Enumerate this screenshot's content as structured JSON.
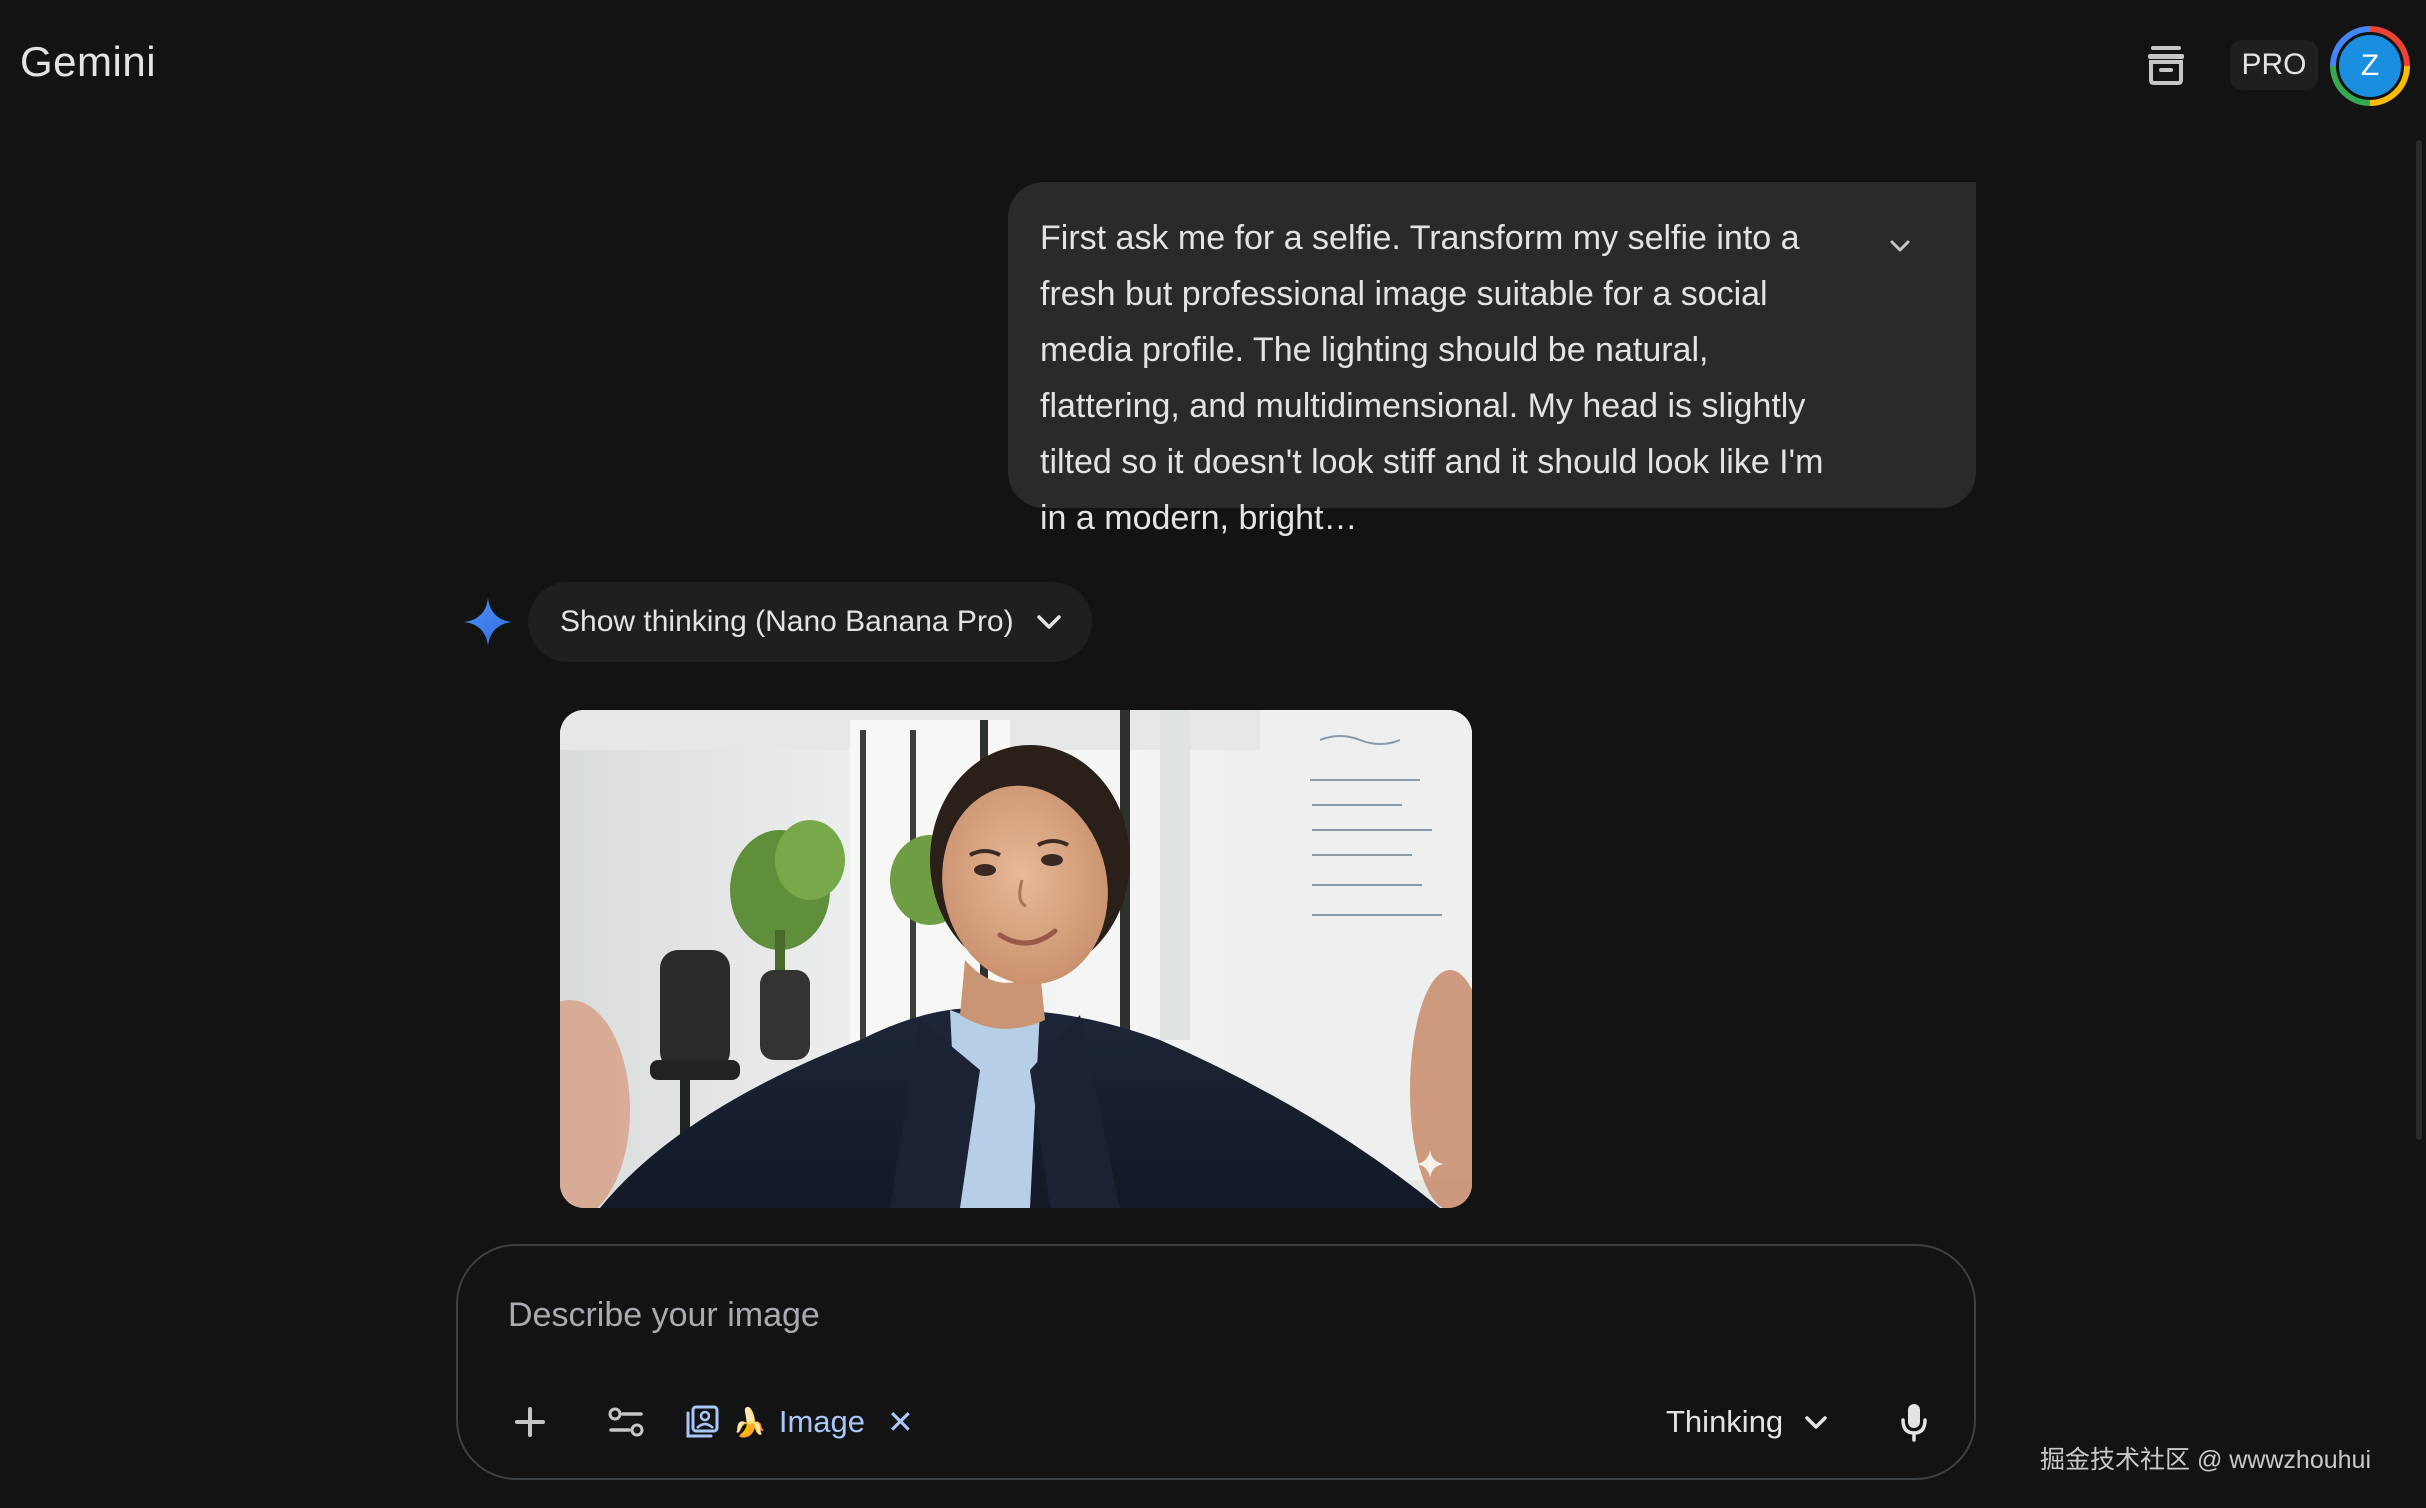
{
  "app": {
    "title": "Gemini"
  },
  "header": {
    "pro_label": "PRO",
    "avatar_initial": "Z",
    "icons": [
      "temporary-chat-icon"
    ]
  },
  "conversation": {
    "user_prompt": "First ask me for a selfie. Transform my selfie into a fresh but professional image suitable for a social media profile. The lighting should be natural, flattering, and multidimensional. My head is slightly tilted so it doesn't look stiff and it should look like I'm in a modern, bright…",
    "response": {
      "thinking_label": "Show thinking (Nano Banana Pro)",
      "image_description": "generated-professional-selfie"
    }
  },
  "composer": {
    "placeholder": "Describe your image",
    "tool_chip_label": "Image",
    "tool_chip_emoji": "🍌",
    "mode_label": "Thinking"
  },
  "watermark": "掘金技术社区 @ wwwzhouhui",
  "colors": {
    "background": "#131313",
    "bubble": "#282a2c",
    "accent_blue": "#a8c7fa",
    "avatar": "#1a8fe0"
  }
}
